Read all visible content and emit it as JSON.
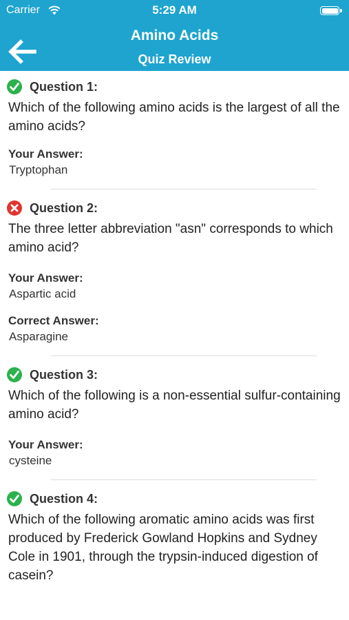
{
  "status_bar": {
    "carrier": "Carrier",
    "time": "5:29 AM"
  },
  "nav": {
    "title": "Amino Acids",
    "subtitle": "Quiz Review"
  },
  "labels": {
    "your_answer": "Your Answer:",
    "correct_answer": "Correct Answer:"
  },
  "colors": {
    "header": "#1ea4cf",
    "correct": "#2bb24c",
    "incorrect": "#e0342f"
  },
  "questions": [
    {
      "label": "Question 1:",
      "status": "correct",
      "icon": "check-circle-icon",
      "text": "Which of the following amino acids is the largest of all the amino acids?",
      "your_answer": "Tryptophan"
    },
    {
      "label": "Question 2:",
      "status": "incorrect",
      "icon": "x-circle-icon",
      "text": "The three letter abbreviation \"asn\" corresponds to which amino acid?",
      "your_answer": "Aspartic acid",
      "correct_answer": "Asparagine"
    },
    {
      "label": "Question 3:",
      "status": "correct",
      "icon": "check-circle-icon",
      "text": "Which of the following is a non-essential sulfur-containing amino acid?",
      "your_answer": "cysteine"
    },
    {
      "label": "Question 4:",
      "status": "correct",
      "icon": "check-circle-icon",
      "text": "Which of the following aromatic amino acids was first produced by Frederick Gowland Hopkins and Sydney Cole in 1901, through the trypsin-induced digestion of casein?"
    }
  ]
}
